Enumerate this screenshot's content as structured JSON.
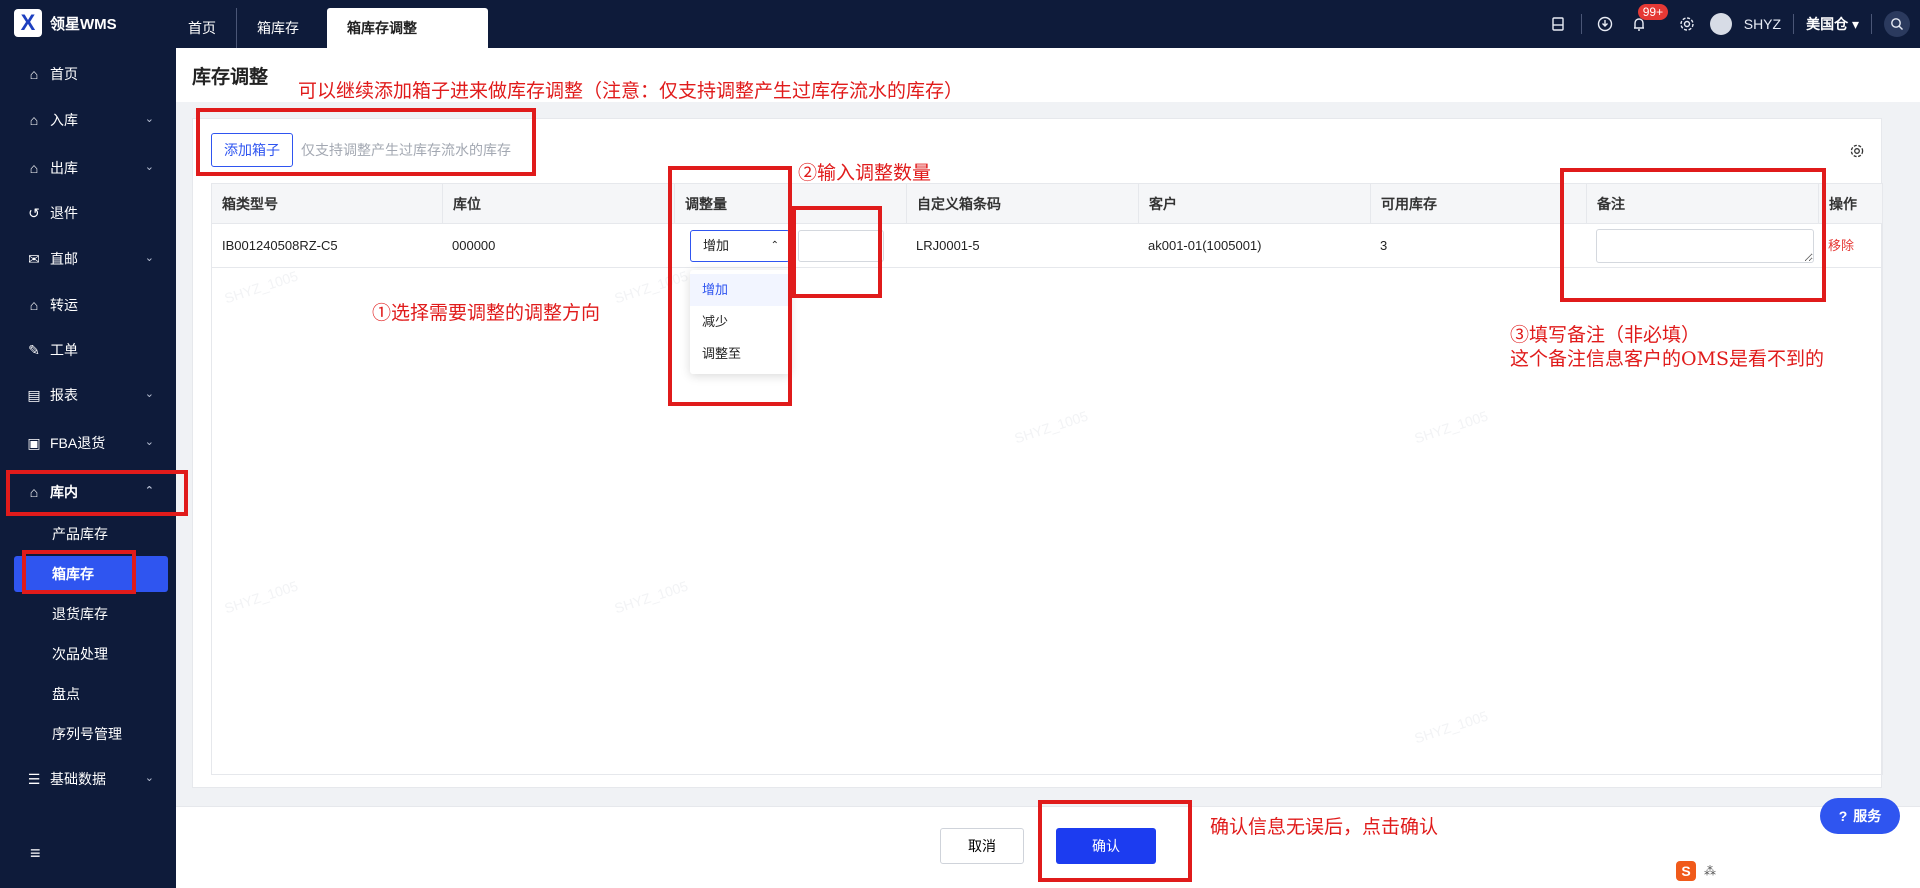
{
  "app": {
    "logo_text": "领星WMS",
    "logo_glyph": "X"
  },
  "tabs": [
    "首页",
    "箱库存",
    "箱库存调整"
  ],
  "topbar": {
    "notification_badge": "99+",
    "user": "SHYZ",
    "warehouse": "美国仓",
    "icons": [
      "printer-icon",
      "download-icon",
      "bell-icon",
      "settings-icon",
      "search-icon"
    ]
  },
  "sidebar": {
    "items": [
      {
        "label": "首页",
        "icon": "home-icon"
      },
      {
        "label": "入库",
        "icon": "inbound-icon",
        "has_children": true
      },
      {
        "label": "出库",
        "icon": "outbound-icon",
        "has_children": true
      },
      {
        "label": "退件",
        "icon": "return-icon"
      },
      {
        "label": "直邮",
        "icon": "mail-icon",
        "has_children": true
      },
      {
        "label": "转运",
        "icon": "transfer-icon"
      },
      {
        "label": "工单",
        "icon": "ticket-icon"
      },
      {
        "label": "报表",
        "icon": "report-icon",
        "has_children": true
      },
      {
        "label": "FBA退货",
        "icon": "fba-icon",
        "has_children": true
      },
      {
        "label": "库内",
        "icon": "warehouse-icon",
        "expanded": true
      },
      {
        "label": "基础数据",
        "icon": "grid-icon",
        "has_children": true
      }
    ],
    "sub_items": [
      "产品库存",
      "箱库存",
      "退货库存",
      "次品处理",
      "盘点",
      "序列号管理"
    ]
  },
  "page": {
    "title": "库存调整"
  },
  "toolbar": {
    "add_box_label": "添加箱子",
    "hint": "仅支持调整产生过库存流水的库存"
  },
  "table": {
    "columns": [
      "箱类型号",
      "库位",
      "调整量",
      "自定义箱条码",
      "客户",
      "可用库存",
      "备注",
      "操作"
    ],
    "rows": [
      {
        "box_type": "IB001240508RZ-C5",
        "location": "000000",
        "adjust_direction": "增加",
        "custom_barcode": "LRJ0001-5",
        "customer": "ak001-01(1005001)",
        "available": "3",
        "action": "移除"
      }
    ],
    "dropdown_options": [
      "增加",
      "减少",
      "调整至"
    ]
  },
  "footer": {
    "cancel_label": "取消",
    "confirm_label": "确认"
  },
  "service": {
    "label": "服务"
  },
  "ime": {
    "glyph": "S"
  },
  "watermark": "SHYZ_1005",
  "annotations": {
    "top": "可以继续添加箱子进来做库存调整（注意：仅支持调整产生过库存流水的库存）",
    "step1": "①选择需要调整的调整方向",
    "step2": "②输入调整数量",
    "step3_line1": "③填写备注（非必填）",
    "step3_line2": "这个备注信息客户的OMS是看不到的",
    "confirm": "确认信息无误后，点击确认"
  },
  "colors": {
    "sidebar_bg": "#0e1b3a",
    "primary": "#2f55f0",
    "annotation": "#e01b1b",
    "danger": "#e53935"
  }
}
